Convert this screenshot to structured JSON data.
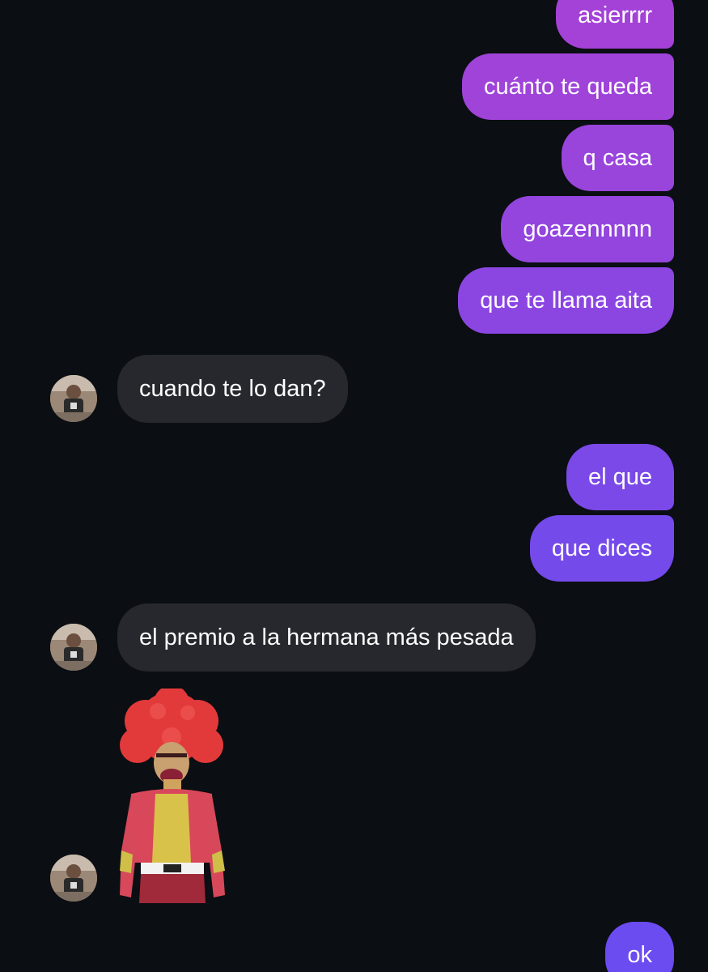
{
  "colors": {
    "background": "#0b0e13",
    "incoming_bubble": "#26282d",
    "outgoing_top": "#a543d6",
    "outgoing_bottom": "#6a4cf0"
  },
  "messages": [
    {
      "id": "m1",
      "direction": "outgoing",
      "text": "asierrrr",
      "color": "#a041d8"
    },
    {
      "id": "m2",
      "direction": "outgoing",
      "text": "cuánto te queda",
      "color": "#9c42da"
    },
    {
      "id": "m3",
      "direction": "outgoing",
      "text": "q casa",
      "color": "#9644dc"
    },
    {
      "id": "m4",
      "direction": "outgoing",
      "text": "goazennnnn",
      "color": "#9045df"
    },
    {
      "id": "m5",
      "direction": "outgoing",
      "text": "que te llama aita",
      "color": "#8a46e2"
    },
    {
      "id": "m6",
      "direction": "incoming",
      "text": "cuando te lo dan?"
    },
    {
      "id": "m7",
      "direction": "outgoing",
      "text": "el que",
      "color": "#7a49e8"
    },
    {
      "id": "m8",
      "direction": "outgoing",
      "text": "que dices",
      "color": "#744aea"
    },
    {
      "id": "m9",
      "direction": "incoming",
      "text": "el premio a la hermana más pesada"
    },
    {
      "id": "m10",
      "direction": "incoming",
      "type": "sticker",
      "icon": "clown-boxer-sticker"
    },
    {
      "id": "m11",
      "direction": "outgoing",
      "text": "ok",
      "color": "#6a4cf0"
    }
  ],
  "contact": {
    "avatar_icon": "contact-avatar-icon"
  }
}
